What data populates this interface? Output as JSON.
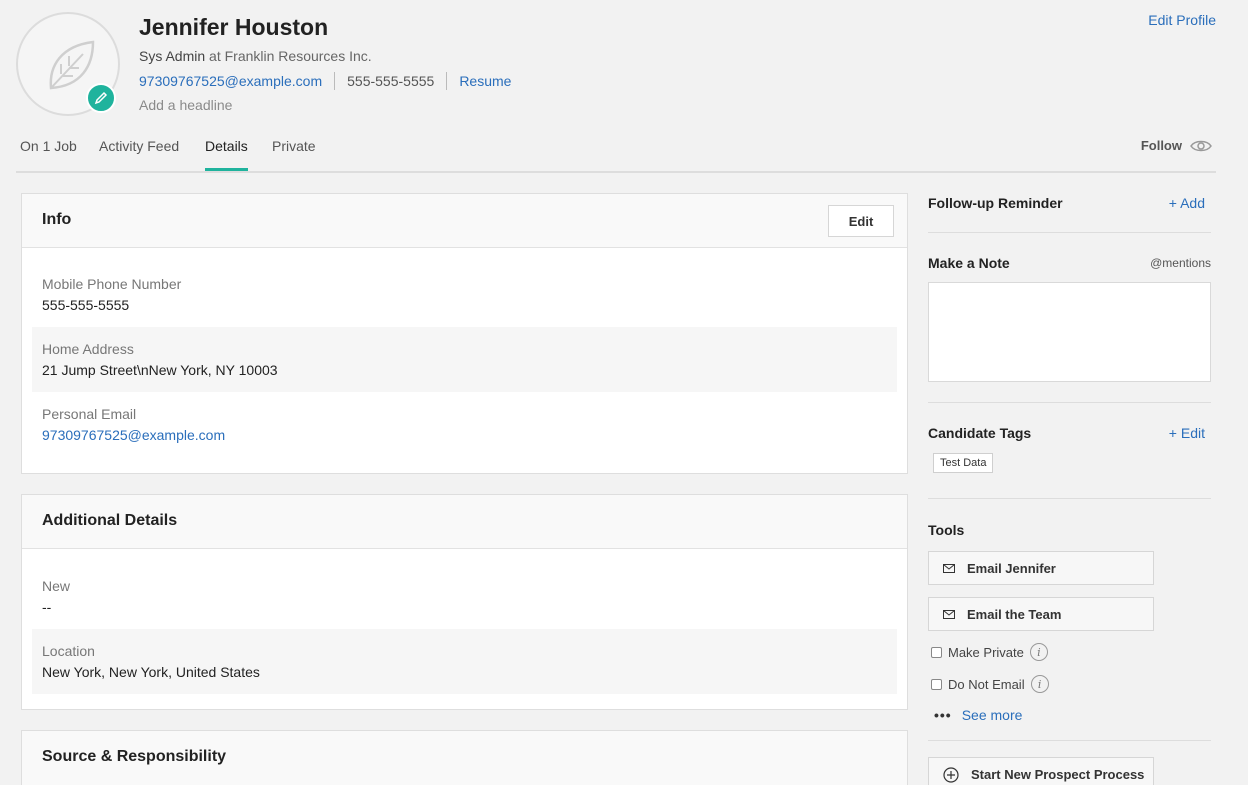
{
  "profile": {
    "name": "Jennifer Houston",
    "role": "Sys Admin",
    "at_word": "at",
    "company": "Franklin Resources Inc.",
    "email": "97309767525@example.com",
    "phone": "555-555-5555",
    "resume_link": "Resume",
    "headline_placeholder": "Add a headline",
    "edit_profile": "Edit Profile"
  },
  "tabs": [
    {
      "label": "On 1 Job"
    },
    {
      "label": "Activity Feed"
    },
    {
      "label": "Details",
      "active": true
    },
    {
      "label": "Private"
    }
  ],
  "follow_label": "Follow",
  "info": {
    "title": "Info",
    "edit_label": "Edit",
    "fields": [
      {
        "label": "Mobile Phone Number",
        "value": "555-555-5555"
      },
      {
        "label": "Home Address",
        "value": "21 Jump Street\\nNew York, NY 10003"
      },
      {
        "label": "Personal Email",
        "value": "97309767525@example.com"
      }
    ]
  },
  "additional": {
    "title": "Additional Details",
    "fields": [
      {
        "label": "New",
        "value": "--"
      },
      {
        "label": "Location",
        "value": "New York, New York, United States"
      }
    ]
  },
  "source": {
    "title": "Source & Responsibility"
  },
  "sidebar": {
    "reminder": {
      "title": "Follow-up Reminder",
      "action": "+ Add"
    },
    "note": {
      "title": "Make a Note",
      "mentions": "@mentions"
    },
    "tags": {
      "title": "Candidate Tags",
      "action": "+ Edit",
      "items": [
        "Test Data"
      ]
    },
    "tools": {
      "title": "Tools",
      "email_candidate": "Email Jennifer",
      "email_team": "Email the Team",
      "make_private": "Make Private",
      "do_not_email": "Do Not Email",
      "see_more": "See more",
      "start_process": "Start New Prospect Process"
    }
  },
  "colors": {
    "accent": "#1fb39d",
    "link": "#2a6ebb"
  }
}
